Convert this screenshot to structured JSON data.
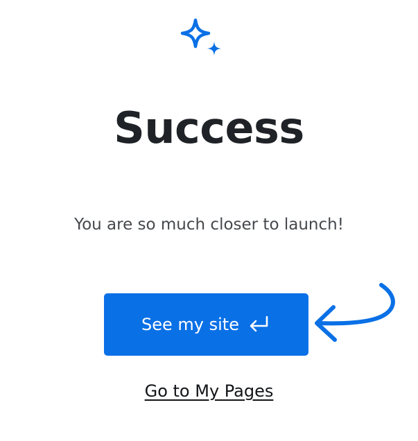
{
  "page": {
    "icon": "sparkle-icon",
    "title": "Success",
    "message": "You are so much closer to launch!",
    "primary_button": {
      "label": "See my site",
      "icon": "enter-return-icon"
    },
    "secondary_link": "Go to My Pages",
    "pointer": "curved-arrow-icon"
  },
  "colors": {
    "accent": "#0a70e6",
    "title": "#1f2226",
    "text": "#45484c",
    "background": "#ffffff"
  }
}
